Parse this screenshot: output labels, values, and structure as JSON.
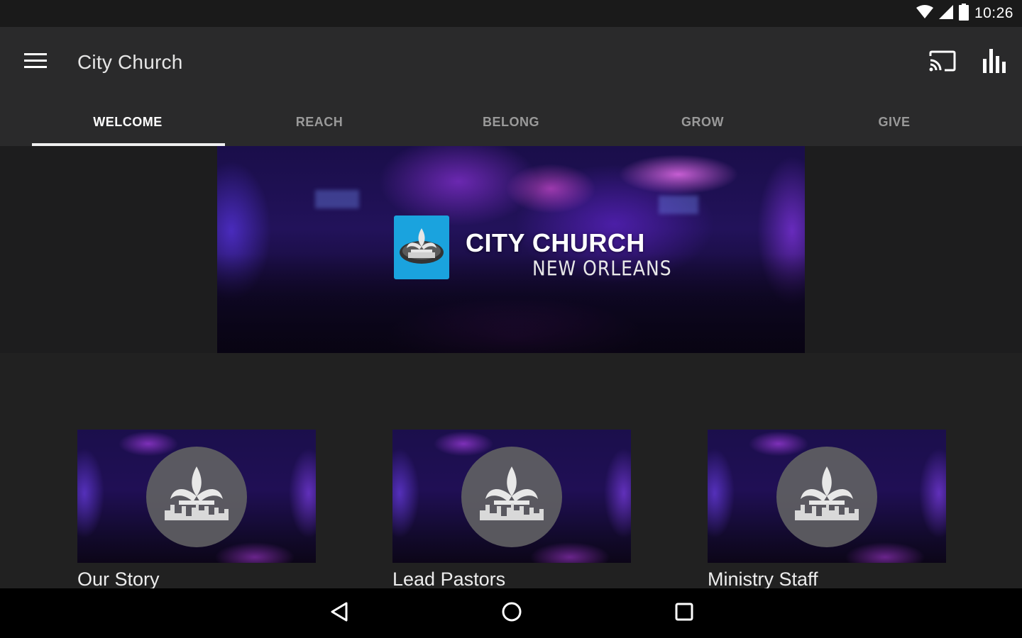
{
  "status_bar": {
    "time": "10:26",
    "icons": [
      "wifi-icon",
      "cell-signal-icon",
      "battery-icon"
    ]
  },
  "app_bar": {
    "title": "City Church",
    "icons": {
      "menu": "hamburger-menu-icon",
      "cast": "cast-icon",
      "stats": "bar-chart-icon"
    }
  },
  "tabs": [
    {
      "label": "WELCOME",
      "active": true
    },
    {
      "label": "REACH",
      "active": false
    },
    {
      "label": "BELONG",
      "active": false
    },
    {
      "label": "GROW",
      "active": false
    },
    {
      "label": "GIVE",
      "active": false
    }
  ],
  "hero": {
    "logo_title": "CITY CHURCH",
    "logo_subtitle": "NEW ORLEANS",
    "logo_color": "#1aa3de"
  },
  "cards": [
    {
      "label": "Our Story"
    },
    {
      "label": "Lead Pastors"
    },
    {
      "label": "Ministry Staff"
    }
  ],
  "nav_bar": {
    "icons": [
      "back-icon",
      "home-icon",
      "recents-icon"
    ]
  },
  "colors": {
    "app_bar": "#2a2a2b",
    "background": "#212121",
    "tab_indicator": "#f0f0f0",
    "nav_bar": "#000000"
  }
}
